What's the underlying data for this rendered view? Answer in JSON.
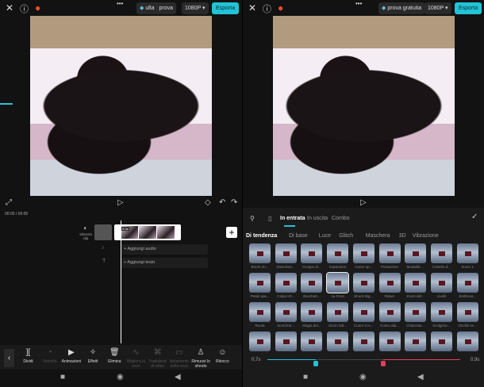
{
  "left": {
    "top": {
      "close_icon": "close",
      "help_icon": "help",
      "flame_icon": "flame",
      "more": "•••",
      "trial_a": "ulta",
      "trial_b": "prova",
      "resolution": "1080P ▾",
      "export": "Esporta"
    },
    "timecode": "00:00 / 00:05",
    "timeline": {
      "mute_label": "Silenzia clip",
      "clip_duration": "5.0s",
      "add_audio": "+ Aggiungi audio",
      "add_text": "+ Aggiungi testo",
      "add_button": "+"
    },
    "toolbar": [
      {
        "label": "Dividi",
        "icon": "split",
        "enabled": true
      },
      {
        "label": "Velocità",
        "icon": "speed",
        "enabled": false
      },
      {
        "label": "Animazioni",
        "icon": "animation",
        "enabled": true
      },
      {
        "label": "Effetti",
        "icon": "effects",
        "enabled": true
      },
      {
        "label": "Elimina",
        "icon": "delete",
        "enabled": true
      },
      {
        "label": "Migliora la voce",
        "icon": "voice",
        "enabled": false
      },
      {
        "label": "Traduttore di video",
        "icon": "translate",
        "enabled": false
      },
      {
        "label": "Isolamento della voce",
        "icon": "isolate",
        "enabled": false
      },
      {
        "label": "Rimuovi lo sfondo",
        "icon": "remove-bg",
        "enabled": true
      },
      {
        "label": "Ritocco",
        "icon": "retouch",
        "enabled": true
      }
    ]
  },
  "right": {
    "top": {
      "trial": "prova gratuita",
      "resolution": "1080P ▾",
      "export": "Esporta"
    },
    "tabs": [
      "In entrata",
      "In uscita",
      "Combo"
    ],
    "active_tab": "In entrata",
    "categories": [
      "Di tendenza",
      "Di base",
      "Luce",
      "Glitch",
      "Maschera",
      "3D",
      "Vibrazione"
    ],
    "active_category": "Di tendenza",
    "effects": [
      [
        "Boom en...",
        "Dissolven...",
        "Gruppo di...",
        "Espansion",
        "Cuore sp...",
        "Pulsazione",
        "Modalità ...",
        "Cubetto d...",
        "Zoom 1"
      ],
      [
        "Petali spa...",
        "Colpo inf...",
        "Bacchett...",
        "na Fiore",
        "Shock Big...",
        "Riduci",
        "Zoom def...",
        "Livelli",
        "Elettricar..."
      ],
      [
        "Ruota",
        "Scorrime...",
        "Magia del...",
        "Zoom tab...",
        "Cuore in e...",
        "Conto alla...",
        "Chiamata...",
        "Svolgime...",
        "Oscilla ve..."
      ],
      [
        "",
        "",
        "",
        "",
        "",
        "",
        "",
        "",
        ""
      ]
    ],
    "selected_effect": "na Fiore",
    "slider": {
      "min_label": "0,7s",
      "max_label": "0,9s",
      "in_value": 0.25,
      "out_value": 0.6
    },
    "accent": "#22c3d6",
    "out_color": "#e0405a"
  }
}
